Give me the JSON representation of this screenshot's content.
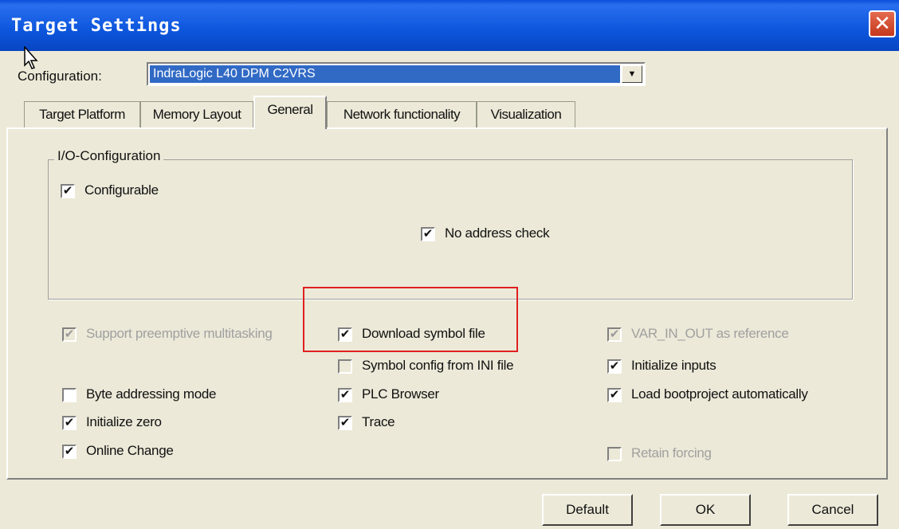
{
  "window": {
    "title": "Target Settings",
    "close_symbol": "✕"
  },
  "configuration": {
    "label": "Configuration:",
    "value": "IndraLogic L40 DPM C2VRS",
    "dropdown_symbol": "▼"
  },
  "tabs": [
    {
      "label": "Target Platform"
    },
    {
      "label": "Memory Layout"
    },
    {
      "label": "General",
      "active": true
    },
    {
      "label": "Network functionality"
    },
    {
      "label": "Visualization"
    }
  ],
  "io_group": {
    "label": "I/O-Configuration",
    "configurable": {
      "label": "Configurable",
      "checked": true
    },
    "no_address_check": {
      "label": "No address check",
      "checked": true
    }
  },
  "options": {
    "support_preemptive": {
      "label": "Support preemptive multitasking",
      "checked": true,
      "disabled": true
    },
    "download_symbol": {
      "label": "Download symbol file",
      "checked": true
    },
    "var_in_out": {
      "label": "VAR_IN_OUT as reference",
      "checked": true,
      "disabled": true
    },
    "symbol_config_ini": {
      "label": "Symbol config from INI file",
      "checked": false,
      "disabled": true
    },
    "initialize_inputs": {
      "label": "Initialize inputs",
      "checked": true
    },
    "byte_addressing": {
      "label": "Byte addressing mode",
      "checked": false
    },
    "plc_browser": {
      "label": "PLC Browser",
      "checked": true
    },
    "load_bootproject": {
      "label": "Load bootproject automatically",
      "checked": true
    },
    "initialize_zero": {
      "label": "Initialize zero",
      "checked": true
    },
    "trace": {
      "label": "Trace",
      "checked": true
    },
    "online_change": {
      "label": "Online Change",
      "checked": true
    },
    "retain_forcing": {
      "label": "Retain forcing",
      "checked": false,
      "disabled": true
    }
  },
  "buttons": {
    "default": "Default",
    "ok": "OK",
    "cancel": "Cancel"
  },
  "check_mark": "✔",
  "colors": {
    "titlebar": "#0a4fd8",
    "selection": "#316ac5",
    "highlight_box": "#e02020"
  }
}
